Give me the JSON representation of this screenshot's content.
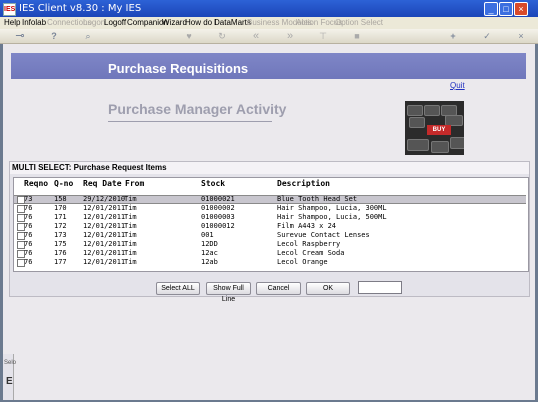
{
  "window": {
    "title": "IES Client v8.30 : My IES",
    "icon_label": "IES",
    "controls": {
      "minimize": "_",
      "maximize": "□",
      "close": "×"
    }
  },
  "menu": [
    {
      "label": "Help",
      "enabled": true
    },
    {
      "label": "Infolab",
      "enabled": true
    },
    {
      "label": "Connections",
      "enabled": false
    },
    {
      "label": "Logon",
      "enabled": false
    },
    {
      "label": "Logoff",
      "enabled": true
    },
    {
      "label": "Companion",
      "enabled": true
    },
    {
      "label": "Wizard",
      "enabled": true
    },
    {
      "label": "How do I",
      "enabled": true
    },
    {
      "label": "DataMarts",
      "enabled": true
    },
    {
      "label": "Business Modules",
      "enabled": false
    },
    {
      "label": "Action Focus",
      "enabled": false
    },
    {
      "label": "Option Select",
      "enabled": false
    }
  ],
  "toolbar": {
    "icons": [
      "key-icon",
      "help-icon",
      "search-icon",
      "heart-icon",
      "refresh-icon",
      "rewind-icon",
      "fast-forward-icon",
      "filter-icon",
      "stop-icon",
      "add-icon",
      "confirm-icon",
      "close-icon"
    ],
    "glyphs": {
      "key": "⊸",
      "help": "?",
      "search": "⌕",
      "heart": "♥",
      "refresh": "↻",
      "rewind": "«",
      "ffwd": "»",
      "filter": "⊤",
      "stop": "■",
      "add": "+",
      "confirm": "✓",
      "close": "×"
    }
  },
  "page": {
    "banner_title": "Purchase Requisitions",
    "quit_label": "Quit",
    "activity_title": "Purchase Manager Activity",
    "image_key_label": "BUY"
  },
  "multi_select": {
    "title": "MULTI SELECT: Purchase Request Items",
    "columns": [
      "Reqno",
      "Q-no",
      "Req Date",
      "From",
      "Stock",
      "Description"
    ],
    "rows": [
      {
        "reqno": "73",
        "qno": "158",
        "date": "29/12/2010",
        "from": "Tim",
        "stock": "01000021",
        "desc": "Blue Tooth Head Set",
        "selected": true
      },
      {
        "reqno": "76",
        "qno": "170",
        "date": "12/01/2011",
        "from": "Tim",
        "stock": "01000002",
        "desc": "Hair Shampoo, Lucia, 300ML",
        "selected": false
      },
      {
        "reqno": "76",
        "qno": "171",
        "date": "12/01/2011",
        "from": "Tim",
        "stock": "01000003",
        "desc": "Hair Shampoo, Lucia, 500ML",
        "selected": false
      },
      {
        "reqno": "76",
        "qno": "172",
        "date": "12/01/2011",
        "from": "Tim",
        "stock": "01000012",
        "desc": "Film A443 x 24",
        "selected": false
      },
      {
        "reqno": "76",
        "qno": "173",
        "date": "12/01/2011",
        "from": "Tim",
        "stock": "001",
        "desc": "Surevue Contact Lenses",
        "selected": false
      },
      {
        "reqno": "76",
        "qno": "175",
        "date": "12/01/2011",
        "from": "Tim",
        "stock": "12DD",
        "desc": "Lecol Raspberry",
        "selected": false
      },
      {
        "reqno": "76",
        "qno": "176",
        "date": "12/01/2011",
        "from": "Tim",
        "stock": "12ac",
        "desc": "Lecol Cream Soda",
        "selected": false
      },
      {
        "reqno": "76",
        "qno": "177",
        "date": "12/01/2011",
        "from": "Tim",
        "stock": "12ab",
        "desc": "Lecol Orange",
        "selected": false
      }
    ],
    "buttons": {
      "select_all": "Select ALL",
      "show_full_line": "Show Full Line",
      "cancel": "Cancel",
      "ok": "OK"
    },
    "search_value": ""
  },
  "side_panel": {
    "label": "Selo",
    "letter": "E"
  },
  "colors": {
    "titlebar": "#1b45b8",
    "banner": "#7279bd",
    "activity_text": "#9e9eae",
    "link": "#2030c0",
    "buy_key": "#c42a2a"
  }
}
